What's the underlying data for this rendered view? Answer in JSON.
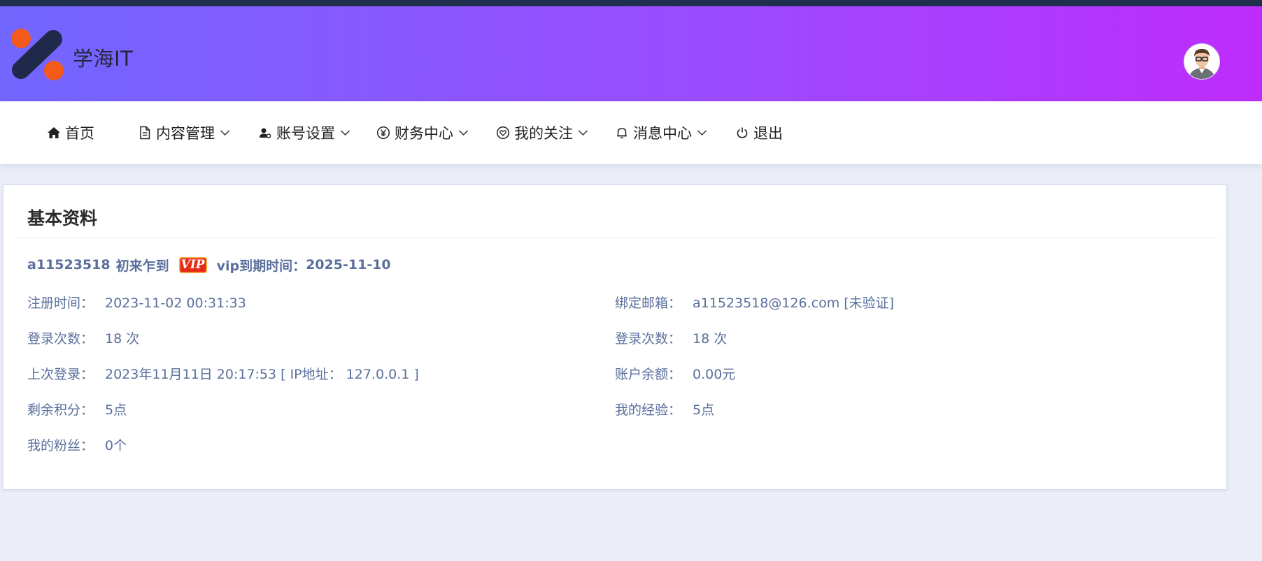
{
  "header": {
    "brand": "学海IT",
    "colors": {
      "gradient_start": "#7266ff",
      "gradient_end": "#be2cfc",
      "logo_dark": "#1f2a4a",
      "logo_orange": "#f45a1a"
    }
  },
  "nav": {
    "items": [
      {
        "label": "首页",
        "icon": "home-icon",
        "has_dropdown": false
      },
      {
        "label": "内容管理",
        "icon": "document-icon",
        "has_dropdown": true
      },
      {
        "label": "账号设置",
        "icon": "user-settings-icon",
        "has_dropdown": true
      },
      {
        "label": "财务中心",
        "icon": "yen-icon",
        "has_dropdown": true
      },
      {
        "label": "我的关注",
        "icon": "heart-icon",
        "has_dropdown": true
      },
      {
        "label": "消息中心",
        "icon": "bell-icon",
        "has_dropdown": true
      },
      {
        "label": "退出",
        "icon": "power-icon",
        "has_dropdown": false
      }
    ]
  },
  "profile": {
    "title": "基本资料",
    "username": "a11523518",
    "rank": "初来乍到",
    "vip_badge": "VIP",
    "vip_expiry_label": "vip到期时间：",
    "vip_expiry": "2025-11-10",
    "left": [
      {
        "label": "注册时间：",
        "value": "2023-11-02 00:31:33"
      },
      {
        "label": "登录次数：",
        "value": "18 次"
      },
      {
        "label": "上次登录：",
        "value": "2023年11月11日 20:17:53 [ IP地址：  127.0.0.1 ]"
      },
      {
        "label": "剩余积分：",
        "value": "5点"
      },
      {
        "label": "我的粉丝：",
        "value": "0个"
      }
    ],
    "right": [
      {
        "label": "绑定邮箱：",
        "value": "a11523518@126.com [未验证]"
      },
      {
        "label": "登录次数：",
        "value": "18 次"
      },
      {
        "label": "账户余额：",
        "value": "0.00元"
      },
      {
        "label": "我的经验：",
        "value": "5点"
      }
    ]
  }
}
